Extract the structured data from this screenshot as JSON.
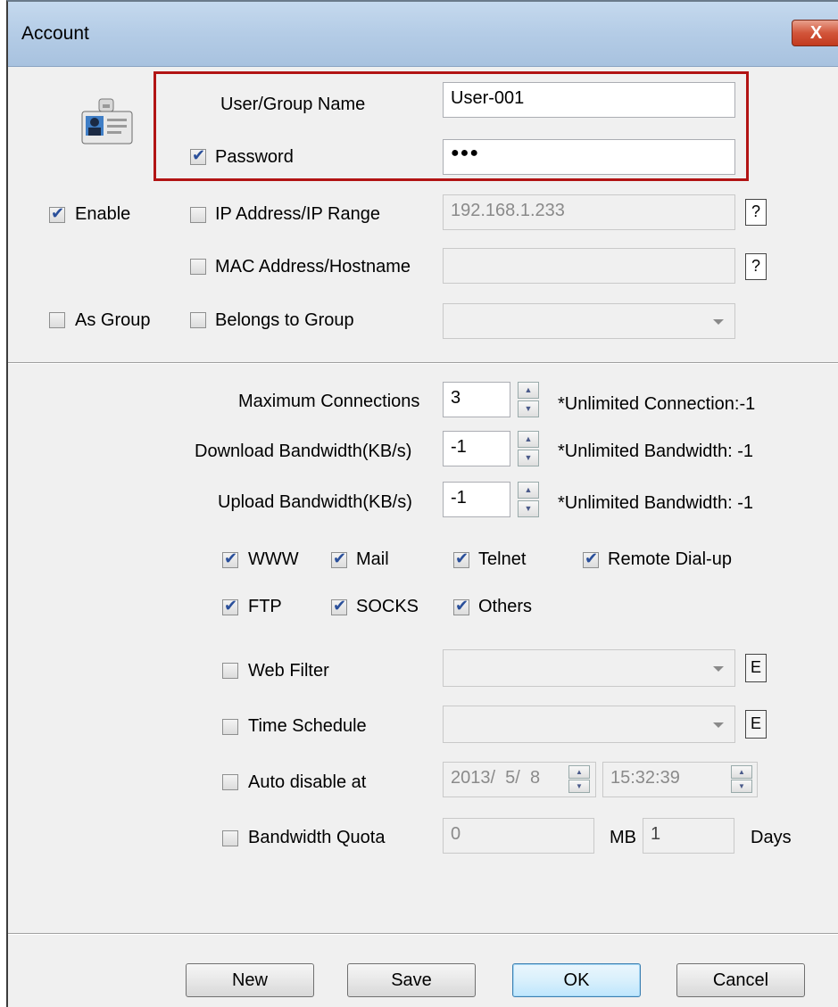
{
  "window": {
    "title": "Account",
    "close_label": "X"
  },
  "identity": {
    "user_group_name_label": "User/Group Name",
    "user_group_name_value": "User-001",
    "password_label": "Password",
    "password_checked": true,
    "password_value": "●●●"
  },
  "flags": {
    "enable_label": "Enable",
    "enable_checked": true,
    "as_group_label": "As Group",
    "as_group_checked": false
  },
  "address": {
    "ip_label": "IP Address/IP Range",
    "ip_value": "192.168.1.233",
    "mac_label": "MAC Address/Hostname",
    "mac_value": "",
    "belongs_label": "Belongs to Group",
    "belongs_value": "",
    "help_label": "?"
  },
  "limits": {
    "max_conn_label": "Maximum Connections",
    "max_conn_value": "3",
    "max_conn_note": "*Unlimited Connection:-1",
    "download_label": "Download Bandwidth(KB/s)",
    "download_value": "-1",
    "download_note": "*Unlimited Bandwidth: -1",
    "upload_label": "Upload Bandwidth(KB/s)",
    "upload_value": "-1",
    "upload_note": "*Unlimited Bandwidth: -1"
  },
  "services": [
    {
      "label": "WWW",
      "checked": true
    },
    {
      "label": "Mail",
      "checked": true
    },
    {
      "label": "Telnet",
      "checked": true
    },
    {
      "label": "Remote Dial-up",
      "checked": true
    },
    {
      "label": "FTP",
      "checked": true
    },
    {
      "label": "SOCKS",
      "checked": true
    },
    {
      "label": "Others",
      "checked": true
    }
  ],
  "filters": {
    "web_filter_label": "Web Filter",
    "time_schedule_label": "Time Schedule",
    "edit_label": "E",
    "auto_disable_label": "Auto disable at",
    "auto_disable_date": "2013/  5/  8",
    "auto_disable_time": "15:32:39",
    "quota_label": "Bandwidth Quota",
    "quota_value": "0",
    "quota_unit": "MB",
    "quota_days_value": "1",
    "quota_days_label": "Days"
  },
  "buttons": {
    "new": "New",
    "save": "Save",
    "ok": "OK",
    "cancel": "Cancel"
  },
  "colors": {
    "highlight": "#b21414",
    "titlebar": "#b4cce6",
    "close": "#d2553a"
  }
}
